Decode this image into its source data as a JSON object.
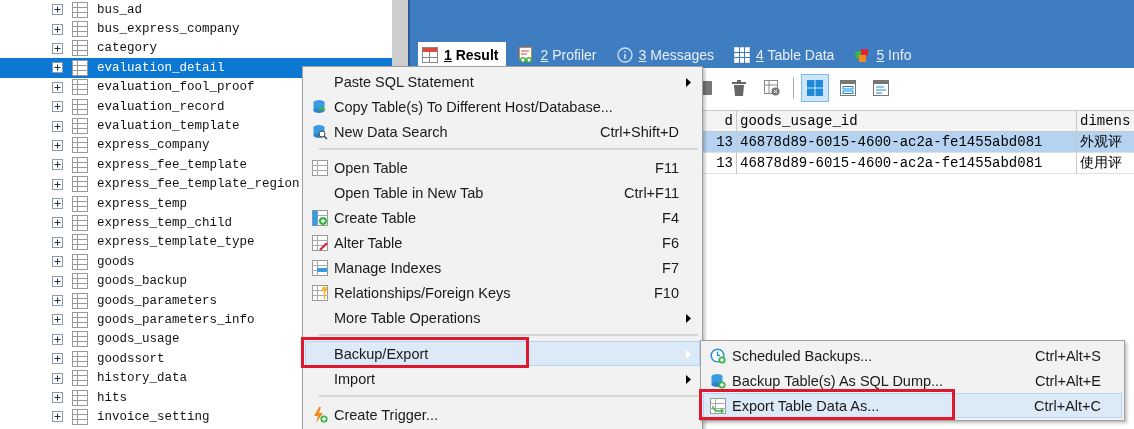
{
  "tree": {
    "items": [
      {
        "name": "bus_ad",
        "expanded": false,
        "selected": false
      },
      {
        "name": "bus_express_company",
        "expanded": false,
        "selected": false
      },
      {
        "name": "category",
        "expanded": false,
        "selected": false
      },
      {
        "name": "evaluation_detail",
        "expanded": false,
        "selected": true
      },
      {
        "name": "evaluation_fool_proof",
        "expanded": false,
        "selected": false
      },
      {
        "name": "evaluation_record",
        "expanded": false,
        "selected": false
      },
      {
        "name": "evaluation_template",
        "expanded": false,
        "selected": false
      },
      {
        "name": "express_company",
        "expanded": false,
        "selected": false
      },
      {
        "name": "express_fee_template",
        "expanded": false,
        "selected": false
      },
      {
        "name": "express_fee_template_region",
        "expanded": false,
        "selected": false
      },
      {
        "name": "express_temp",
        "expanded": false,
        "selected": false
      },
      {
        "name": "express_temp_child",
        "expanded": false,
        "selected": false
      },
      {
        "name": "express_template_type",
        "expanded": false,
        "selected": false
      },
      {
        "name": "goods",
        "expanded": false,
        "selected": false
      },
      {
        "name": "goods_backup",
        "expanded": false,
        "selected": false
      },
      {
        "name": "goods_parameters",
        "expanded": false,
        "selected": false
      },
      {
        "name": "goods_parameters_info",
        "expanded": false,
        "selected": false
      },
      {
        "name": "goods_usage",
        "expanded": false,
        "selected": false
      },
      {
        "name": "goodssort",
        "expanded": false,
        "selected": false
      },
      {
        "name": "history_data",
        "expanded": false,
        "selected": false
      },
      {
        "name": "hits",
        "expanded": false,
        "selected": false
      },
      {
        "name": "invoice_setting",
        "expanded": false,
        "selected": false
      }
    ]
  },
  "tabs": [
    {
      "number": "1",
      "label": "Result",
      "selected": true
    },
    {
      "number": "2",
      "label": "Profiler",
      "selected": false
    },
    {
      "number": "3",
      "label": "Messages",
      "selected": false
    },
    {
      "number": "4",
      "label": "Table Data",
      "selected": false
    },
    {
      "number": "5",
      "label": "Info",
      "selected": false
    }
  ],
  "toolbar": {
    "buttons": [
      {
        "kind": "save",
        "selected": false
      },
      {
        "kind": "trash",
        "selected": false
      },
      {
        "kind": "discard",
        "selected": false
      },
      {
        "kind": "grid",
        "selected": true
      },
      {
        "kind": "form",
        "selected": false
      },
      {
        "kind": "text",
        "selected": false
      }
    ]
  },
  "grid": {
    "columns": [
      "d",
      "goods_usage_id",
      "dimens"
    ],
    "rows": [
      {
        "selected": true,
        "cells": [
          "13",
          "46878d89-6015-4600-ac2a-fe1455abd081",
          "外观评"
        ]
      },
      {
        "selected": false,
        "cells": [
          "13",
          "46878d89-6015-4600-ac2a-fe1455abd081",
          "使用评"
        ]
      }
    ]
  },
  "context_menu": {
    "items": [
      {
        "kind": "item",
        "label": "Paste SQL Statement",
        "submenu": true,
        "selected": false,
        "highlighted": false
      },
      {
        "kind": "item",
        "label": "Copy Table(s) To Different Host/Database...",
        "submenu": false,
        "selected": false,
        "highlighted": false
      },
      {
        "kind": "item",
        "label": "New Data Search",
        "shortcut": "Ctrl+Shift+D",
        "submenu": false,
        "selected": false,
        "highlighted": false
      },
      {
        "kind": "separator"
      },
      {
        "kind": "item",
        "label": "Open Table",
        "shortcut": "F11",
        "submenu": false,
        "selected": false,
        "highlighted": false
      },
      {
        "kind": "item",
        "label": "Open Table in New Tab",
        "shortcut": "Ctrl+F11",
        "submenu": false,
        "selected": false,
        "highlighted": false
      },
      {
        "kind": "item",
        "label": "Create Table",
        "shortcut": "F4",
        "submenu": false,
        "selected": false,
        "highlighted": false
      },
      {
        "kind": "item",
        "label": "Alter Table",
        "shortcut": "F6",
        "submenu": false,
        "selected": false,
        "highlighted": false
      },
      {
        "kind": "item",
        "label": "Manage Indexes",
        "shortcut": "F7",
        "submenu": false,
        "selected": false,
        "highlighted": false
      },
      {
        "kind": "item",
        "label": "Relationships/Foreign Keys",
        "shortcut": "F10",
        "submenu": false,
        "selected": false,
        "highlighted": false
      },
      {
        "kind": "item",
        "label": "More Table Operations",
        "submenu": true,
        "selected": false,
        "highlighted": false
      },
      {
        "kind": "separator"
      },
      {
        "kind": "item",
        "label": "Backup/Export",
        "submenu": true,
        "selected": true,
        "highlighted": true
      },
      {
        "kind": "item",
        "label": "Import",
        "submenu": true,
        "selected": false,
        "highlighted": false
      },
      {
        "kind": "separator"
      },
      {
        "kind": "item",
        "label": "Create Trigger...",
        "submenu": false,
        "selected": false,
        "highlighted": false
      }
    ]
  },
  "submenu": {
    "items": [
      {
        "label": "Scheduled Backups...",
        "shortcut": "Ctrl+Alt+S",
        "selected": false,
        "highlighted": false
      },
      {
        "label": "Backup Table(s) As SQL Dump...",
        "shortcut": "Ctrl+Alt+E",
        "selected": false,
        "highlighted": false
      },
      {
        "label": "Export Table Data As...",
        "shortcut": "Ctrl+Alt+C",
        "selected": true,
        "highlighted": true
      }
    ]
  }
}
